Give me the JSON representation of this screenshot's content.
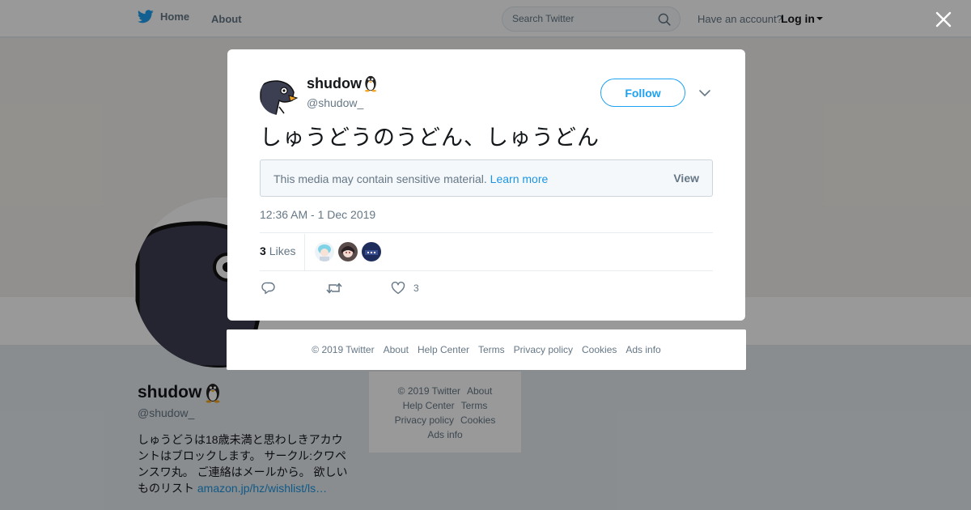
{
  "topbar": {
    "home_label": "Home",
    "about_label": "About",
    "search_placeholder": "Search Twitter",
    "account_prompt": "Have an account?",
    "login_label": "Log in"
  },
  "profile": {
    "name": "shudow",
    "handle": "@shudow_",
    "bio_text": "しゅうどうは18歳未満と思わしきアカウントはブロックします。 サークル:クワペンスワ丸。 ご連絡はメールから。 欲しいものリスト ",
    "bio_link": "amazon.jp/hz/wishlist/ls…"
  },
  "side_footer": {
    "links": [
      "© 2019 Twitter",
      "About",
      "Help Center",
      "Terms",
      "Privacy policy",
      "Cookies",
      "Ads info"
    ]
  },
  "tweet": {
    "author_name": "shudow",
    "author_handle": "@shudow_",
    "follow_label": "Follow",
    "text": "しゅうどうのうどん、しゅうどん",
    "sensitive_notice": "This media may contain sensitive material.",
    "learn_more": "Learn more",
    "view_label": "View",
    "timestamp": "12:36 AM - 1 Dec 2019",
    "likes_count": "3",
    "likes_label": "Likes",
    "like_action_count": "3"
  },
  "modal_footer": {
    "links": [
      "© 2019 Twitter",
      "About",
      "Help Center",
      "Terms",
      "Privacy policy",
      "Cookies",
      "Ads info"
    ]
  },
  "colors": {
    "twitter_blue": "#1da1f2",
    "link_blue": "#1b95e0",
    "muted_text": "#657786",
    "overlay": "rgba(0,0,0,0.4)"
  },
  "icons": [
    "twitter-bird-icon",
    "search-icon",
    "close-icon",
    "penguin-emoji-icon",
    "chevron-down-icon",
    "reply-icon",
    "retweet-icon",
    "heart-icon"
  ]
}
